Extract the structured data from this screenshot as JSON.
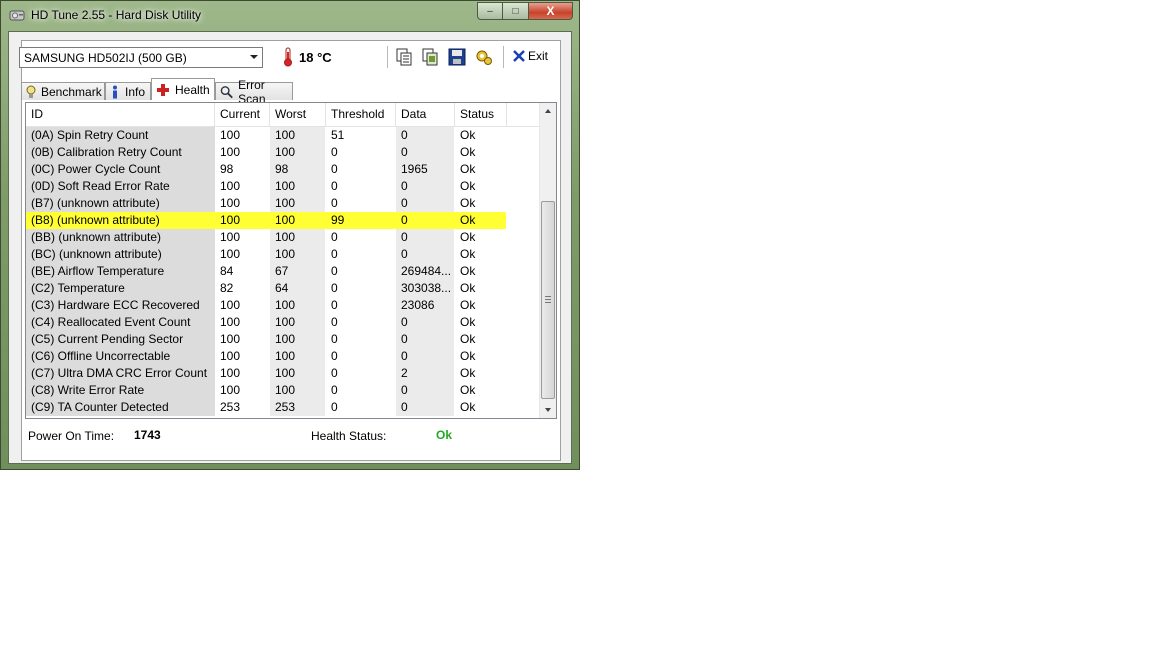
{
  "window": {
    "title": "HD Tune 2.55 - Hard Disk Utility",
    "controls": {
      "minimize": "–",
      "maximize": "□",
      "close": "X"
    }
  },
  "toolbar": {
    "drive": "SAMSUNG HD502IJ (500 GB)",
    "temperature": "18 °C",
    "buttons": [
      "copy-text-icon",
      "copy-screenshot-icon",
      "save-icon",
      "options-icon"
    ],
    "exit_label": "Exit"
  },
  "tabs": [
    {
      "label": "Benchmark",
      "icon": "benchmark-icon"
    },
    {
      "label": "Info",
      "icon": "info-icon"
    },
    {
      "label": "Health",
      "icon": "health-cross-icon",
      "active": true
    },
    {
      "label": "Error Scan",
      "icon": "magnifier-icon"
    }
  ],
  "table": {
    "columns": [
      "ID",
      "Current",
      "Worst",
      "Threshold",
      "Data",
      "Status"
    ],
    "rows": [
      {
        "id": "(0A) Spin Retry Count",
        "current": "100",
        "worst": "100",
        "threshold": "51",
        "data": "0",
        "status": "Ok"
      },
      {
        "id": "(0B) Calibration Retry Count",
        "current": "100",
        "worst": "100",
        "threshold": "0",
        "data": "0",
        "status": "Ok"
      },
      {
        "id": "(0C) Power Cycle Count",
        "current": "98",
        "worst": "98",
        "threshold": "0",
        "data": "1965",
        "status": "Ok"
      },
      {
        "id": "(0D) Soft Read Error Rate",
        "current": "100",
        "worst": "100",
        "threshold": "0",
        "data": "0",
        "status": "Ok"
      },
      {
        "id": "(B7) (unknown attribute)",
        "current": "100",
        "worst": "100",
        "threshold": "0",
        "data": "0",
        "status": "Ok"
      },
      {
        "id": "(B8) (unknown attribute)",
        "current": "100",
        "worst": "100",
        "threshold": "99",
        "data": "0",
        "status": "Ok",
        "highlight": true
      },
      {
        "id": "(BB) (unknown attribute)",
        "current": "100",
        "worst": "100",
        "threshold": "0",
        "data": "0",
        "status": "Ok"
      },
      {
        "id": "(BC) (unknown attribute)",
        "current": "100",
        "worst": "100",
        "threshold": "0",
        "data": "0",
        "status": "Ok"
      },
      {
        "id": "(BE) Airflow Temperature",
        "current": "84",
        "worst": "67",
        "threshold": "0",
        "data": "269484...",
        "status": "Ok"
      },
      {
        "id": "(C2) Temperature",
        "current": "82",
        "worst": "64",
        "threshold": "0",
        "data": "303038...",
        "status": "Ok"
      },
      {
        "id": "(C3) Hardware ECC Recovered",
        "current": "100",
        "worst": "100",
        "threshold": "0",
        "data": "23086",
        "status": "Ok"
      },
      {
        "id": "(C4) Reallocated Event Count",
        "current": "100",
        "worst": "100",
        "threshold": "0",
        "data": "0",
        "status": "Ok"
      },
      {
        "id": "(C5) Current Pending Sector",
        "current": "100",
        "worst": "100",
        "threshold": "0",
        "data": "0",
        "status": "Ok"
      },
      {
        "id": "(C6) Offline Uncorrectable",
        "current": "100",
        "worst": "100",
        "threshold": "0",
        "data": "0",
        "status": "Ok"
      },
      {
        "id": "(C7) Ultra DMA CRC Error Count",
        "current": "100",
        "worst": "100",
        "threshold": "0",
        "data": "2",
        "status": "Ok"
      },
      {
        "id": "(C8) Write Error Rate",
        "current": "100",
        "worst": "100",
        "threshold": "0",
        "data": "0",
        "status": "Ok"
      },
      {
        "id": "(C9) TA Counter Detected",
        "current": "253",
        "worst": "253",
        "threshold": "0",
        "data": "0",
        "status": "Ok"
      }
    ]
  },
  "footer": {
    "power_on_label": "Power On Time:",
    "power_on_value": "1743",
    "health_label": "Health Status:",
    "health_value": "Ok"
  },
  "colors": {
    "highlight": "#ffff33",
    "health_ok": "#22aa22",
    "accent_red": "#cc2222"
  }
}
